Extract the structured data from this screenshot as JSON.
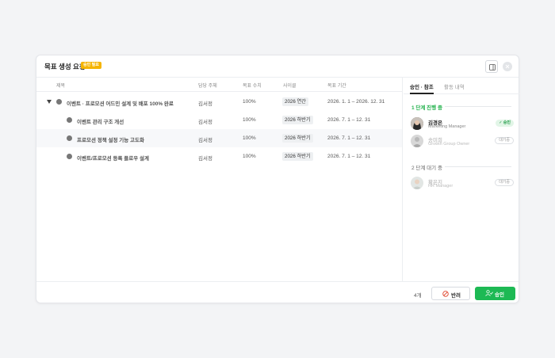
{
  "modal": {
    "title": "목표 생성 요청",
    "badge": "승인 필요"
  },
  "table": {
    "headers": {
      "name": "제목",
      "owner": "담당 주체",
      "value": "목표 수치",
      "cycle": "사이클",
      "period": "목표 기간"
    },
    "rows": [
      {
        "name": "이벤트 · 프로모션 어드민 설계 및 배포 100% 완료",
        "owner": "김서정",
        "value": "100%",
        "cycle": "2026 연간",
        "period": "2026. 1. 1 – 2026. 12. 31"
      },
      {
        "name": "이벤트 관리 구조 개선",
        "owner": "김서정",
        "value": "100%",
        "cycle": "2026 하반기",
        "period": "2026. 7. 1 – 12. 31"
      },
      {
        "name": "프로모션 정책 설정 기능 고도화",
        "owner": "김서정",
        "value": "100%",
        "cycle": "2026 하반기",
        "period": "2026. 7. 1 – 12. 31"
      },
      {
        "name": "이벤트/프로모션 등록 플로우 설계",
        "owner": "김서정",
        "value": "100%",
        "cycle": "2026 하반기",
        "period": "2026. 7. 1 – 12. 31"
      }
    ]
  },
  "side": {
    "tab_active": "승인 · 참조",
    "tab_inactive": "활동 내역",
    "stage1": "1 단계 진행 중",
    "stage2": "2 단계 대기 중",
    "approvers": [
      {
        "name": "김경은",
        "role": "Marketing Manager",
        "status": "승인"
      },
      {
        "name": "송미희",
        "role": "Growth Group Owner",
        "status": "대기중"
      },
      {
        "name": "황은지",
        "role": "HR Manager",
        "status": "대기중"
      }
    ]
  },
  "footer": {
    "count": "4개",
    "reject": "반려",
    "approve": "승인"
  },
  "colors": {
    "accent": "#1db954",
    "badge": "#f5b400"
  }
}
